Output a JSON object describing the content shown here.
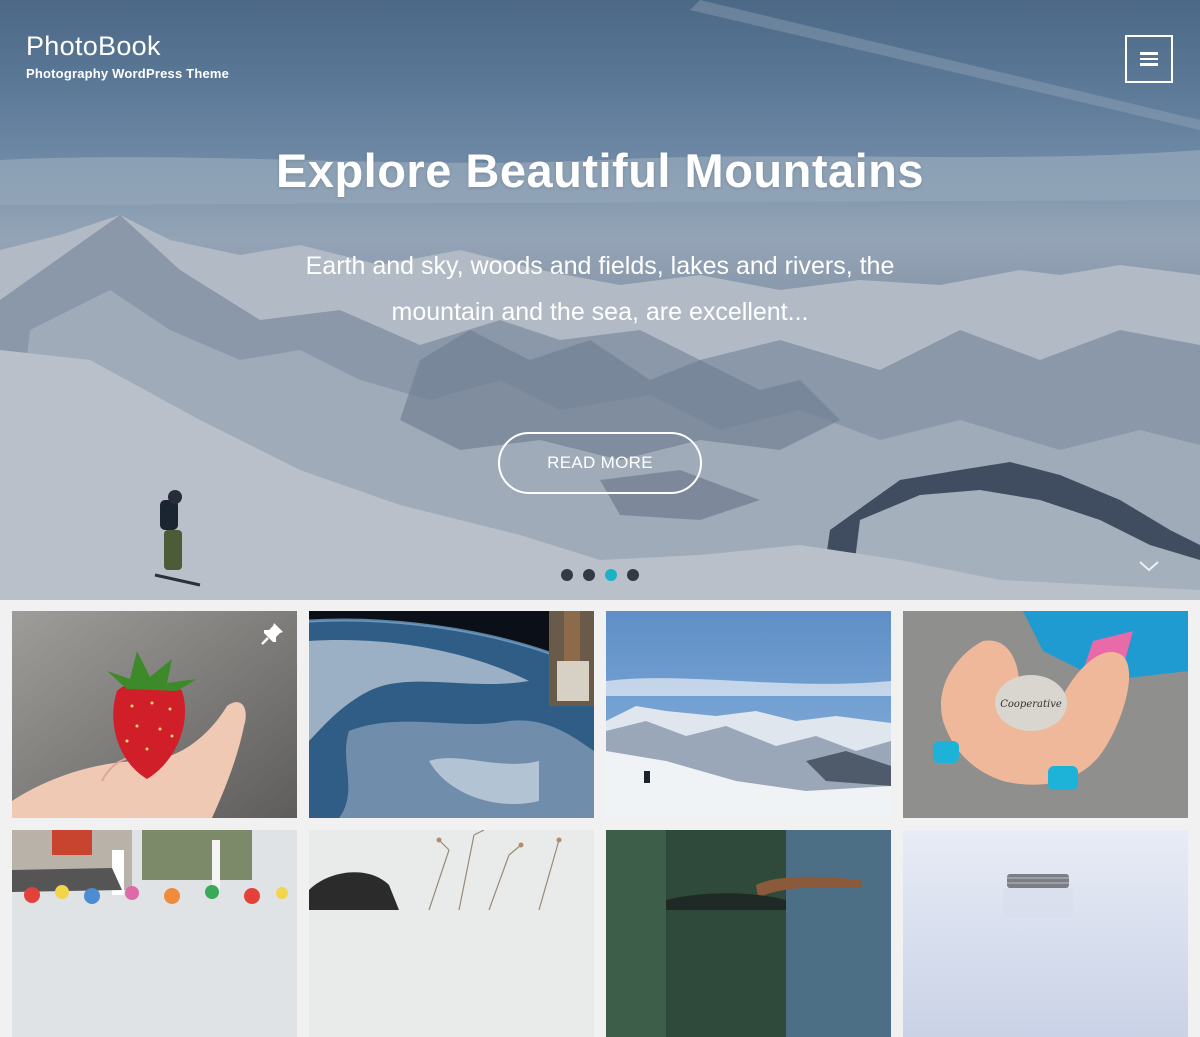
{
  "site": {
    "title": "PhotoBook",
    "description": "Photography WordPress Theme"
  },
  "header": {
    "menu_icon": "hamburger-icon"
  },
  "slider": {
    "title": "Explore Beautiful Mountains",
    "text": "Earth and sky, woods and fields, lakes and rivers, the mountain and the sea, are excellent...",
    "button_label": "READ MORE",
    "slide_count": 4,
    "active_slide": 3,
    "scroll_icon": "chevron-down-icon"
  },
  "grid": {
    "tiles": [
      {
        "subject": "strawberry-on-hand",
        "sticky_icon": "pin-icon"
      },
      {
        "subject": "earth-from-space"
      },
      {
        "subject": "snowy-mountains"
      },
      {
        "subject": "cooperative-stone-in-hands",
        "stone_text": "Cooperative"
      },
      {
        "subject": "street-market"
      },
      {
        "subject": "dry-plants"
      },
      {
        "subject": "forest-scene"
      },
      {
        "subject": "glass-jar"
      }
    ]
  },
  "colors": {
    "accent": "#1ab1c7",
    "dot": "#333a44",
    "page_bg": "#f1f1f1"
  }
}
